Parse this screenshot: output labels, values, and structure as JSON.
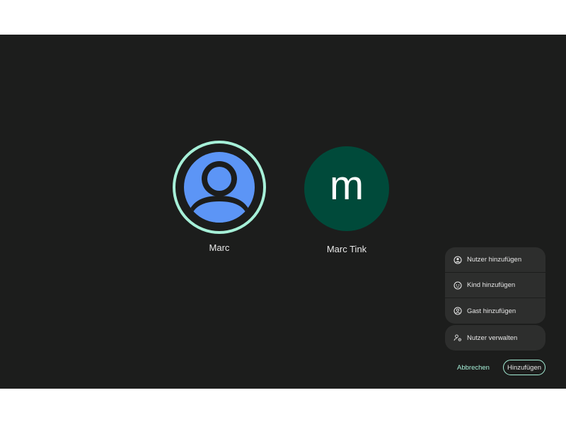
{
  "users": [
    {
      "name": "Marc",
      "avatar": "person-icon",
      "selected": true,
      "avatar_color": "#5c95f6"
    },
    {
      "name": "Marc Tink",
      "initial": "m",
      "avatar_color": "#004a3a"
    }
  ],
  "menu": {
    "items": [
      {
        "label": "Nutzer hinzufügen",
        "icon": "add-user-icon"
      },
      {
        "label": "Kind hinzufügen",
        "icon": "child-icon"
      },
      {
        "label": "Gast hinzufügen",
        "icon": "guest-icon"
      }
    ],
    "manage": {
      "label": "Nutzer verwalten",
      "icon": "manage-users-icon"
    }
  },
  "footer": {
    "cancel_label": "Abbrechen",
    "add_label": "Hinzufügen"
  },
  "colors": {
    "accent": "#a6f0d8",
    "background": "#1c1d1c",
    "surface": "#2d2e2d"
  }
}
